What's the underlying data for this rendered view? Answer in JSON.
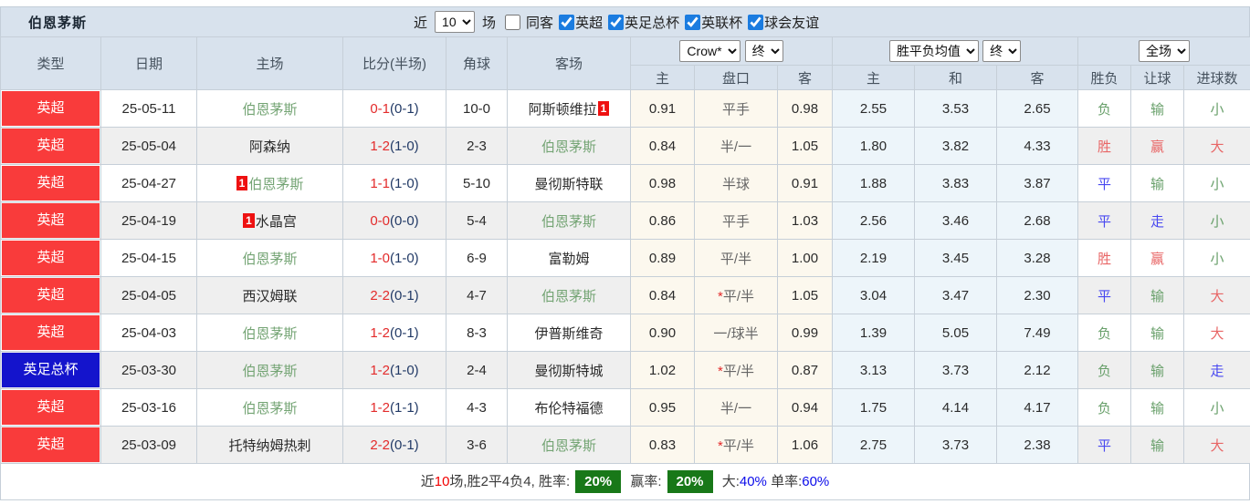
{
  "header": {
    "team": "伯恩茅斯"
  },
  "filters": {
    "near_label": "近",
    "count_value": "10",
    "games_label": "场",
    "same_away_label": "同客",
    "leagues": [
      {
        "label": "英超",
        "checked": "checked"
      },
      {
        "label": "英足总杯",
        "checked": "checked"
      },
      {
        "label": "英联杯",
        "checked": "checked"
      },
      {
        "label": "球会友谊",
        "checked": "checked"
      }
    ]
  },
  "table": {
    "selects": {
      "company": "Crow*",
      "company_state": "终",
      "avg": "胜平负均值",
      "avg_state": "终",
      "scope": "全场"
    },
    "columns": {
      "type": "类型",
      "date": "日期",
      "home": "主场",
      "score": "比分(半场)",
      "corner": "角球",
      "away": "客场",
      "odds_home": "主",
      "odds_handicap": "盘口",
      "odds_away": "客",
      "avg_home": "主",
      "avg_draw": "和",
      "avg_away": "客",
      "result": "胜负",
      "handicap_result": "让球",
      "goals": "进球数"
    },
    "rows": [
      {
        "type": "英超",
        "type_color": "red",
        "date": "25-05-11",
        "home": "伯恩茅斯",
        "home_color": "green",
        "home_badge": "",
        "score_ft": "0-1",
        "score_ht": "(0-1)",
        "corner": "10-0",
        "away": "阿斯顿维拉",
        "away_color": "",
        "away_badge": "1",
        "odds_home": "0.91",
        "handicap_star": "",
        "handicap": "平手",
        "odds_away": "0.98",
        "avg_home": "2.55",
        "avg_draw": "3.53",
        "avg_away": "2.65",
        "result": "负",
        "result_color": "green",
        "handicap_result": "输",
        "handicap_result_color": "green",
        "goals": "小",
        "goals_color": "green"
      },
      {
        "type": "英超",
        "type_color": "red",
        "date": "25-05-04",
        "home": "阿森纳",
        "home_color": "",
        "home_badge": "",
        "score_ft": "1-2",
        "score_ht": "(1-0)",
        "corner": "2-3",
        "away": "伯恩茅斯",
        "away_color": "green",
        "away_badge": "",
        "odds_home": "0.84",
        "handicap_star": "",
        "handicap": "半/一",
        "odds_away": "1.05",
        "avg_home": "1.80",
        "avg_draw": "3.82",
        "avg_away": "4.33",
        "result": "胜",
        "result_color": "red",
        "handicap_result": "赢",
        "handicap_result_color": "red",
        "goals": "大",
        "goals_color": "red"
      },
      {
        "type": "英超",
        "type_color": "red",
        "date": "25-04-27",
        "home": "伯恩茅斯",
        "home_color": "green",
        "home_badge": "1",
        "score_ft": "1-1",
        "score_ht": "(1-0)",
        "corner": "5-10",
        "away": "曼彻斯特联",
        "away_color": "",
        "away_badge": "",
        "odds_home": "0.98",
        "handicap_star": "",
        "handicap": "半球",
        "odds_away": "0.91",
        "avg_home": "1.88",
        "avg_draw": "3.83",
        "avg_away": "3.87",
        "result": "平",
        "result_color": "blue",
        "handicap_result": "输",
        "handicap_result_color": "green",
        "goals": "小",
        "goals_color": "green"
      },
      {
        "type": "英超",
        "type_color": "red",
        "date": "25-04-19",
        "home": "水晶宫",
        "home_color": "",
        "home_badge": "1",
        "score_ft": "0-0",
        "score_ht": "(0-0)",
        "corner": "5-4",
        "away": "伯恩茅斯",
        "away_color": "green",
        "away_badge": "",
        "odds_home": "0.86",
        "handicap_star": "",
        "handicap": "平手",
        "odds_away": "1.03",
        "avg_home": "2.56",
        "avg_draw": "3.46",
        "avg_away": "2.68",
        "result": "平",
        "result_color": "blue",
        "handicap_result": "走",
        "handicap_result_color": "blue",
        "goals": "小",
        "goals_color": "green"
      },
      {
        "type": "英超",
        "type_color": "red",
        "date": "25-04-15",
        "home": "伯恩茅斯",
        "home_color": "green",
        "home_badge": "",
        "score_ft": "1-0",
        "score_ht": "(1-0)",
        "corner": "6-9",
        "away": "富勒姆",
        "away_color": "",
        "away_badge": "",
        "odds_home": "0.89",
        "handicap_star": "",
        "handicap": "平/半",
        "odds_away": "1.00",
        "avg_home": "2.19",
        "avg_draw": "3.45",
        "avg_away": "3.28",
        "result": "胜",
        "result_color": "red",
        "handicap_result": "赢",
        "handicap_result_color": "red",
        "goals": "小",
        "goals_color": "green"
      },
      {
        "type": "英超",
        "type_color": "red",
        "date": "25-04-05",
        "home": "西汉姆联",
        "home_color": "",
        "home_badge": "",
        "score_ft": "2-2",
        "score_ht": "(0-1)",
        "corner": "4-7",
        "away": "伯恩茅斯",
        "away_color": "green",
        "away_badge": "",
        "odds_home": "0.84",
        "handicap_star": "*",
        "handicap": "平/半",
        "odds_away": "1.05",
        "avg_home": "3.04",
        "avg_draw": "3.47",
        "avg_away": "2.30",
        "result": "平",
        "result_color": "blue",
        "handicap_result": "输",
        "handicap_result_color": "green",
        "goals": "大",
        "goals_color": "red"
      },
      {
        "type": "英超",
        "type_color": "red",
        "date": "25-04-03",
        "home": "伯恩茅斯",
        "home_color": "green",
        "home_badge": "",
        "score_ft": "1-2",
        "score_ht": "(0-1)",
        "corner": "8-3",
        "away": "伊普斯维奇",
        "away_color": "",
        "away_badge": "",
        "odds_home": "0.90",
        "handicap_star": "",
        "handicap": "一/球半",
        "odds_away": "0.99",
        "avg_home": "1.39",
        "avg_draw": "5.05",
        "avg_away": "7.49",
        "result": "负",
        "result_color": "green",
        "handicap_result": "输",
        "handicap_result_color": "green",
        "goals": "大",
        "goals_color": "red"
      },
      {
        "type": "英足总杯",
        "type_color": "blue",
        "date": "25-03-30",
        "home": "伯恩茅斯",
        "home_color": "green",
        "home_badge": "",
        "score_ft": "1-2",
        "score_ht": "(1-0)",
        "corner": "2-4",
        "away": "曼彻斯特城",
        "away_color": "",
        "away_badge": "",
        "odds_home": "1.02",
        "handicap_star": "*",
        "handicap": "平/半",
        "odds_away": "0.87",
        "avg_home": "3.13",
        "avg_draw": "3.73",
        "avg_away": "2.12",
        "result": "负",
        "result_color": "green",
        "handicap_result": "输",
        "handicap_result_color": "green",
        "goals": "走",
        "goals_color": "blue"
      },
      {
        "type": "英超",
        "type_color": "red",
        "date": "25-03-16",
        "home": "伯恩茅斯",
        "home_color": "green",
        "home_badge": "",
        "score_ft": "1-2",
        "score_ht": "(1-1)",
        "corner": "4-3",
        "away": "布伦特福德",
        "away_color": "",
        "away_badge": "",
        "odds_home": "0.95",
        "handicap_star": "",
        "handicap": "半/一",
        "odds_away": "0.94",
        "avg_home": "1.75",
        "avg_draw": "4.14",
        "avg_away": "4.17",
        "result": "负",
        "result_color": "green",
        "handicap_result": "输",
        "handicap_result_color": "green",
        "goals": "小",
        "goals_color": "green"
      },
      {
        "type": "英超",
        "type_color": "red",
        "date": "25-03-09",
        "home": "托特纳姆热刺",
        "home_color": "",
        "home_badge": "",
        "score_ft": "2-2",
        "score_ht": "(0-1)",
        "corner": "3-6",
        "away": "伯恩茅斯",
        "away_color": "green",
        "away_badge": "",
        "odds_home": "0.83",
        "handicap_star": "*",
        "handicap": "平/半",
        "odds_away": "1.06",
        "avg_home": "2.75",
        "avg_draw": "3.73",
        "avg_away": "2.38",
        "result": "平",
        "result_color": "blue",
        "handicap_result": "输",
        "handicap_result_color": "green",
        "goals": "大",
        "goals_color": "red"
      }
    ]
  },
  "summary": {
    "near_label": "近",
    "count": "10",
    "record_text": "场,胜2平4负4, 胜率:",
    "win_rate": "20%",
    "handicap_label": "赢率:",
    "handicap_rate": "20%",
    "big_label": "大:",
    "big_rate": "40%",
    "single_label": "单率:",
    "single_rate": "60%"
  },
  "colors": {
    "league_badge_red": "#f93b3b",
    "cup_badge_blue": "#1414cc",
    "win_text_red": "#e86666",
    "draw_text_blue": "#4848f0",
    "lose_text_green": "#69a06b",
    "self_team_green": "#74a474",
    "score_red": "#e32b2b",
    "rate_box_green": "#187818",
    "rate_text_blue": "#0b0bea",
    "header_bg": "#d8e2ed"
  }
}
